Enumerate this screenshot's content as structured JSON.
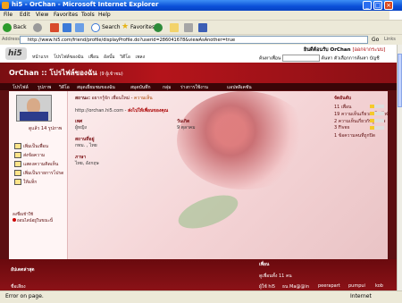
{
  "window": {
    "title": "hi5 - OrChan - Microsoft Internet Explorer",
    "minimize": "_",
    "maximize": "□",
    "close": "×"
  },
  "menu": [
    "File",
    "Edit",
    "View",
    "Favorites",
    "Tools",
    "Help"
  ],
  "toolbar": {
    "back": "Back",
    "search": "Search",
    "favorites": "Favorites"
  },
  "address": {
    "label": "Address",
    "url": "http://www.hi5.com/friend/profile/displayProfile.do?userid=286041678&viewAsAnother=true",
    "go": "Go",
    "links": "Links"
  },
  "site": {
    "logo": "hi5",
    "nav": [
      "หน้าแรก",
      "โปรไฟล์ของฉัน",
      "เพื่อน",
      "อัลบั้ม",
      "วิดีโอ",
      "เพลง"
    ],
    "welcome_prefix": "ยินดีต้อนรับ OrChan",
    "logout": "[ออกจากระบบ]",
    "search_label": "ค้นหาเพื่อน",
    "search_button": "ค้นหา",
    "search_options": "ตัวเลือกการค้นหา",
    "account": "บัญชี",
    "page_title": "OrChan :: โปรไฟล์ของฉัน",
    "page_title_note": "(9 ผู้เข้าชม)"
  },
  "tabs": [
    "โปรไฟล์",
    "รูปภาพ",
    "วิดีโอ",
    "สมุดเยี่ยมชมของฉัน",
    "สมุดบันทึก",
    "กลุ่ม",
    "ร่างการใช้งาน",
    "แอปพลิเคชัน"
  ],
  "profile": {
    "views": "ดูแล้ว 14 รูปภาพ",
    "actions": [
      "เพิ่มเป็นเพื่อน",
      "ส่งข้อความ",
      "แสดงความคิดเห็น",
      "เพิ่มเป็นรายการโปรด",
      "ให้แท็ก"
    ],
    "last_login_label": "ลงชื่อเข้าใช้",
    "online_status": "ออนไลน์อยู่ในขณะนี้",
    "status_label": "สถานะ:",
    "status_text": "อยากรู้จัก เพื่อนใหม่",
    "status_link": "ความเห็น",
    "url": "http://orchan.hi5.com",
    "url_action": "ส่งไปให้เพื่อนของคุณ",
    "gender_label": "เพศ",
    "gender_value": "ผู้หญิง",
    "birthday_label": "วันเกิด",
    "birthday_value": "9 ตุลาคม",
    "location_label": "สถานที่อยู่",
    "location_value": "กทม. , ไทย",
    "language_label": "ภาษา",
    "language_value": "ไทย, อังกฤษ"
  },
  "stats": {
    "title": "จัดอันดับ",
    "items": [
      "11 เพื่อน",
      "19 ความเห็นเกี่ยวกับโปรไฟล์",
      "2 ความเห็นเกี่ยวกับรูปภาพ",
      "3 Fives",
      "1 ข้อความคนที่ถูกปิด"
    ]
  },
  "lower": {
    "recent_title": "อัปเดตล่าสุด",
    "fame_title": "ชื่อเสียง",
    "friends_title": "เพื่อน",
    "friends_count": "ดูเพื่อนทั้ง 11 คน",
    "friends": [
      "ผู้ใช้ hi5",
      "ธน Ma@@in",
      "peerapart",
      "pumpui",
      "kob"
    ]
  },
  "statusbar": {
    "message": "Error on page.",
    "zone": "Internet"
  },
  "colors": {
    "title_bar": "#0a4fd8",
    "page_bg": "#5c0f12",
    "accent_red": "#b5141b"
  }
}
